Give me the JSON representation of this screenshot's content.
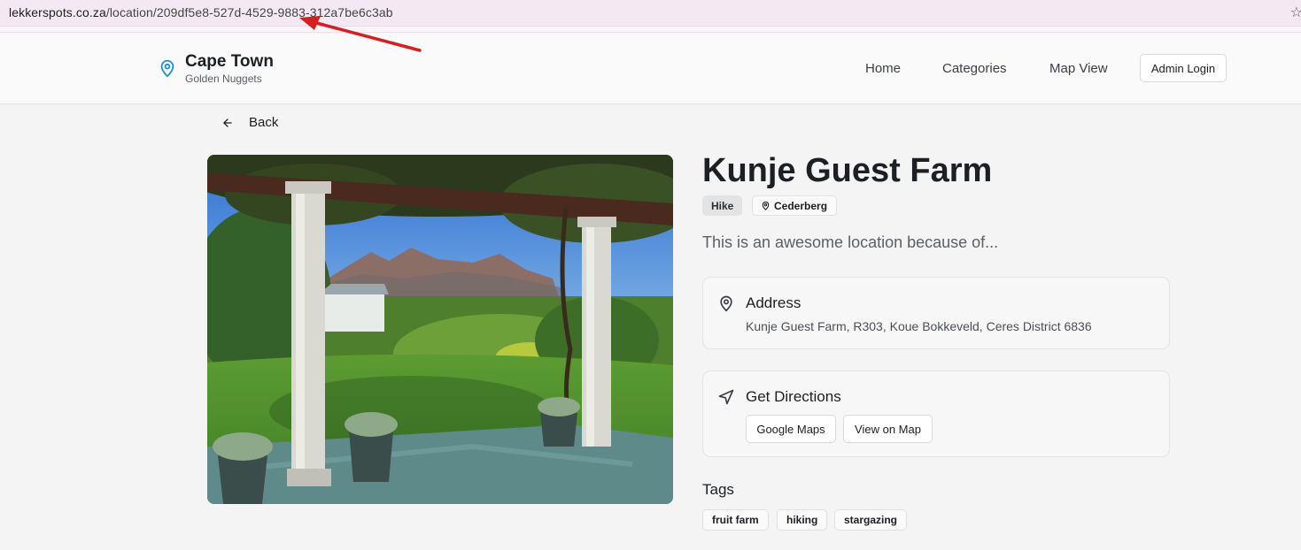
{
  "browser": {
    "url_host": "lekkerspots.co.za",
    "url_path": "/location/209df5e8-527d-4529-9883-312a7be6c3ab",
    "bookmark_icon": "star-icon"
  },
  "annotation": {
    "color": "#d61f1f"
  },
  "header": {
    "brand_title": "Cape Town",
    "brand_subtitle": "Golden Nuggets",
    "brand_icon": "map-pin-icon",
    "accent_color": "#1e90d6",
    "nav": [
      {
        "label": "Home"
      },
      {
        "label": "Categories"
      },
      {
        "label": "Map View"
      }
    ],
    "admin_label": "Admin Login"
  },
  "back_label": "Back",
  "location": {
    "name": "Kunje Guest Farm",
    "category": "Hike",
    "region": "Cederberg",
    "description": "This is an awesome location because of..."
  },
  "address": {
    "title": "Address",
    "text": "Kunje Guest Farm, R303, Koue Bokkeveld, Ceres District 6836"
  },
  "directions": {
    "title": "Get Directions",
    "google_label": "Google Maps",
    "map_label": "View on Map"
  },
  "tags": {
    "title": "Tags",
    "items": [
      "fruit farm",
      "hiking",
      "stargazing"
    ]
  }
}
